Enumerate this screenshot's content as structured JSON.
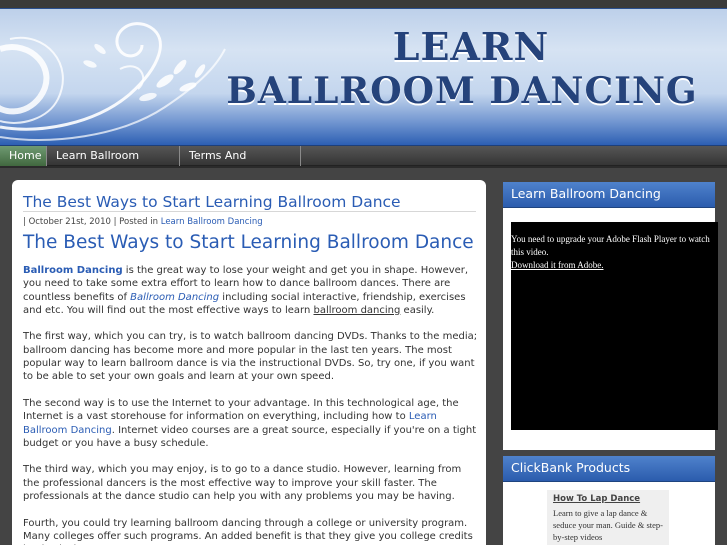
{
  "header": {
    "title_line1": "LEARN",
    "title_line2": "BALLROOM DANCING"
  },
  "nav": {
    "items": [
      {
        "label": "Home"
      },
      {
        "label": "Learn Ballroom Dancing"
      },
      {
        "label": "Terms And Conditions"
      }
    ]
  },
  "post": {
    "title": "The Best Ways to Start Learning Ballroom Dance",
    "meta_prefix": "| October 21st, 2010 | Posted in ",
    "meta_category": "Learn Ballroom Dancing",
    "heading": "The Best Ways to Start Learning Ballroom Dance",
    "p1_a": "Ballroom Dancing",
    "p1_b": " is the great way to lose your weight and get you in shape. However, you need to take some extra effort to learn how to dance ballroom dances. There are countless benefits of ",
    "p1_c": "Ballroom Dancing",
    "p1_d": " including social interactive, friendship, exercises and etc. You will find out the most effective ways to learn ",
    "p1_e": "ballroom dancing",
    "p1_f": " easily.",
    "p2": "The first way, which you can try, is to watch ballroom dancing DVDs. Thanks to the media; ballroom dancing has become more and more popular in the last ten years. The most popular way to learn ballroom dance is via the instructional DVDs. So, try one, if you want to be able to set your own goals and learn at your own speed.",
    "p3_a": "The second way is to use the Internet to your advantage. In this technological age, the Internet is a vast storehouse for information on everything, including how to ",
    "p3_link": "Learn Ballroom Dancing",
    "p3_b": ". Internet video courses are a great source, especially if you're on a tight budget or you have a busy schedule.",
    "p4": "The third way, which you may enjoy, is to go to a dance studio. However, learning from the professional dancers is the most effective way to improve your skill faster. The professionals at the dance studio can help you with any problems you may be having.",
    "p5": "Fourth, you could try learning ballroom dancing through a college or university program. Many colleges offer such programs. An added benefit is that they give you college credits in physical"
  },
  "sidebar": {
    "widget1_title": "Learn Ballroom Dancing",
    "video_message": "You need to upgrade your Adobe Flash Player to watch this video.",
    "video_link": "Download it from Adobe.",
    "widget2_title": "ClickBank Products",
    "ad_title": "How To Lap Dance",
    "ad_desc": "Learn to give a lap dance & seduce your man. Guide & step-by-step videos"
  },
  "colors": {
    "brand_blue": "#2a5cb4",
    "nav_active_green": "#41683f",
    "header_title": "#25437b"
  }
}
